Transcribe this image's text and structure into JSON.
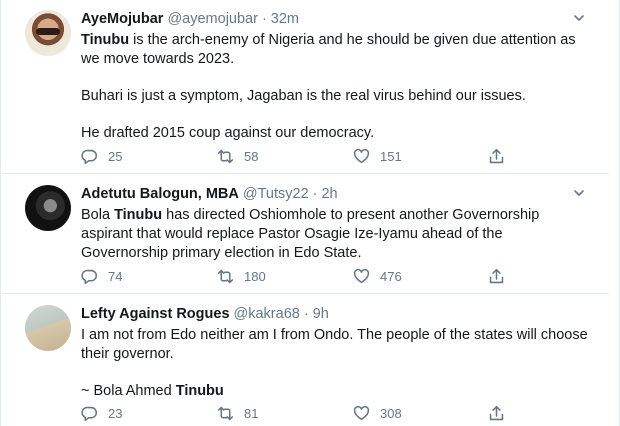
{
  "tweets": [
    {
      "name": "AyeMojubar",
      "handle": "@ayemojubar",
      "separator": "·",
      "time": "32m",
      "line1_bold": "Tinubu",
      "line1_rest": " is the arch-enemy of Nigeria and he should be given due attention as we move towards 2023.",
      "para2": "Buhari is just a symptom, Jagaban is the real virus behind our issues.",
      "para3": "He drafted 2015 coup against our democracy.",
      "replies": "25",
      "retweets": "58",
      "likes": "151"
    },
    {
      "name": "Adetutu Balogun, MBA",
      "handle": "@Tutsy22",
      "separator": "·",
      "time": "2h",
      "line1_pre": "Bola ",
      "line1_bold": "Tinubu",
      "line1_rest": " has directed Oshiomhole to present another Governorship aspirant that would replace Pastor Osagie Ize-Iyamu ahead of the Governorship primary election in Edo State.",
      "replies": "74",
      "retweets": "180",
      "likes": "476"
    },
    {
      "name": "Lefty Against Rogues",
      "handle": "@kakra68",
      "separator": "·",
      "time": "9h",
      "para1": "I am not from Edo neither am I from Ondo. The people of the states will choose their governor.",
      "sig_pre": "~ Bola Ahmed ",
      "sig_bold": "Tinubu",
      "replies": "23",
      "retweets": "81",
      "likes": "308"
    }
  ],
  "icons": {
    "reply": "reply-icon",
    "retweet": "retweet-icon",
    "like": "heart-icon",
    "share": "share-icon",
    "menu": "chevron-down-icon"
  },
  "colors": {
    "text": "#14171a",
    "muted": "#657786",
    "divider": "#e6ecf0"
  }
}
